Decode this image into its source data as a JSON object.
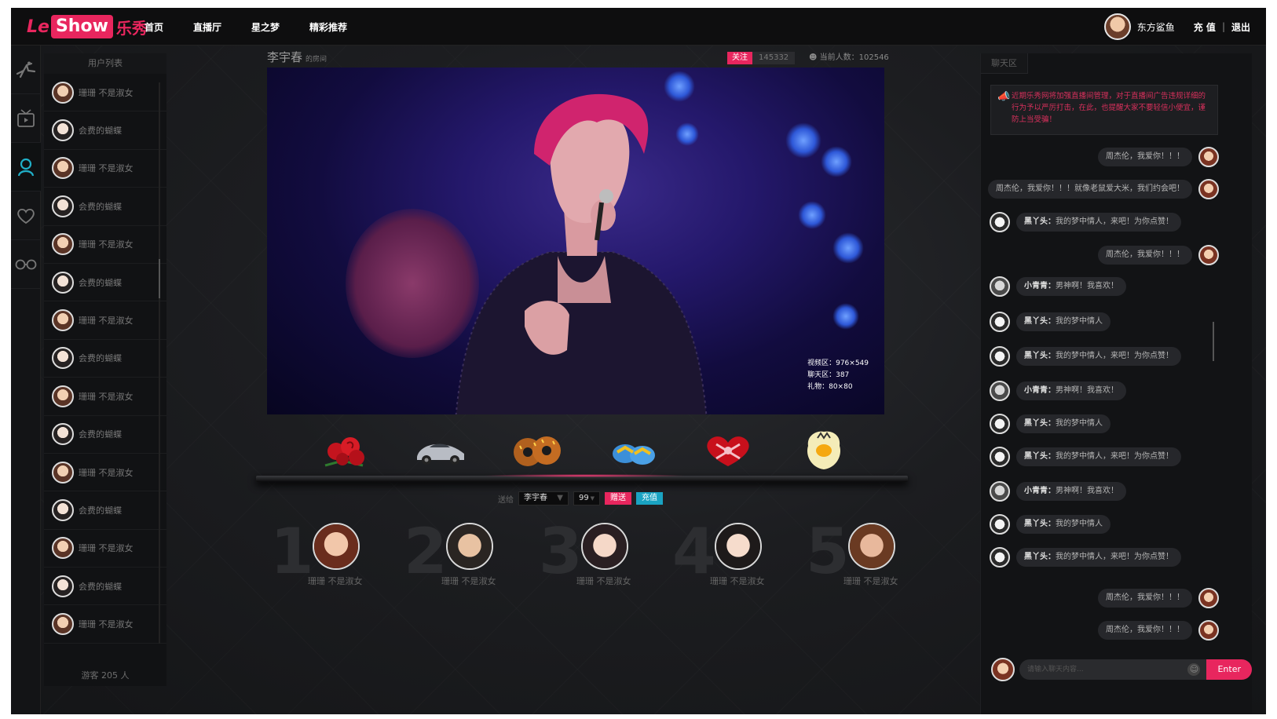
{
  "app": {
    "logo_le": "Le",
    "logo_show": "Show",
    "logo_cn": "乐秀",
    "nav": [
      "首页",
      "直播厅",
      "星之梦",
      "精彩推荐"
    ],
    "user_name": "东方鲨鱼",
    "recharge": "充 值",
    "logout": "退出",
    "sep": "|"
  },
  "rail": [
    "dancer-icon",
    "tv-icon",
    "user-icon",
    "heart-icon",
    "glasses-icon"
  ],
  "user_list": {
    "title": "用户列表",
    "items": [
      "珊珊 不是淑女",
      "会费的蝴蝶",
      "珊珊 不是淑女",
      "会费的蝴蝶",
      "珊珊 不是淑女",
      "会费的蝴蝶",
      "珊珊 不是淑女",
      "会费的蝴蝶",
      "珊珊 不是淑女",
      "会费的蝴蝶",
      "珊珊 不是淑女",
      "会费的蝴蝶",
      "珊珊 不是淑女",
      "会费的蝴蝶",
      "珊珊 不是淑女"
    ],
    "footer": "游客 205 人"
  },
  "room": {
    "name": "李宇春",
    "suffix": "的房间",
    "follow": "关注",
    "follow_count": "145332",
    "online": "当前人数：102546"
  },
  "video_info": [
    "视频区：976×549",
    "聊天区：387",
    "礼物：80×80"
  ],
  "gifts": [
    "rose",
    "car",
    "donuts",
    "slippers",
    "heart-box",
    "egg"
  ],
  "send": {
    "label": "送给",
    "recipient": "李宇春",
    "qty": "99",
    "give": "赠送",
    "recharge": "充值"
  },
  "ranking": [
    {
      "num": "1",
      "name": "珊珊 不是淑女"
    },
    {
      "num": "2",
      "name": "珊珊 不是淑女"
    },
    {
      "num": "3",
      "name": "珊珊 不是淑女"
    },
    {
      "num": "4",
      "name": "珊珊 不是淑女"
    },
    {
      "num": "5",
      "name": "珊珊 不是淑女"
    }
  ],
  "chat": {
    "tab": "聊天区",
    "notice": "近期乐秀网将加强直播间管理，对于直播间广告违规详细的行为予以严厉打击，在此，也提醒大家不要轻信小便宜，谨防上当受骗！",
    "messages": [
      {
        "side": "right",
        "text": "周杰伦，我爱你！！！"
      },
      {
        "side": "right",
        "text": "周杰伦，我爱你！！！就像老鼠爱大米，我们约会吧！"
      },
      {
        "side": "left",
        "name": "黑丫头：",
        "text": "我的梦中情人，来吧！为你点赞！"
      },
      {
        "side": "right",
        "text": "周杰伦，我爱你！！！"
      },
      {
        "side": "left",
        "name": "小青青：",
        "text": "男神啊！我喜欢！"
      },
      {
        "side": "left",
        "name": "黑丫头：",
        "text": "我的梦中情人"
      },
      {
        "side": "left",
        "name": "黑丫头：",
        "text": "我的梦中情人，来吧！为你点赞！"
      },
      {
        "side": "left",
        "name": "小青青：",
        "text": "男神啊！我喜欢！"
      },
      {
        "side": "left",
        "name": "黑丫头：",
        "text": "我的梦中情人"
      },
      {
        "side": "left",
        "name": "黑丫头：",
        "text": "我的梦中情人，来吧！为你点赞！"
      },
      {
        "side": "left",
        "name": "小青青：",
        "text": "男神啊！我喜欢！"
      },
      {
        "side": "left",
        "name": "黑丫头：",
        "text": "我的梦中情人"
      },
      {
        "side": "left",
        "name": "黑丫头：",
        "text": "我的梦中情人，来吧！为你点赞！"
      },
      {
        "side": "right",
        "text": "周杰伦，我爱你！！！"
      },
      {
        "side": "right",
        "text": "周杰伦，我爱你！！！"
      }
    ],
    "input_placeholder": "请输入聊天内容...",
    "send": "Enter"
  }
}
